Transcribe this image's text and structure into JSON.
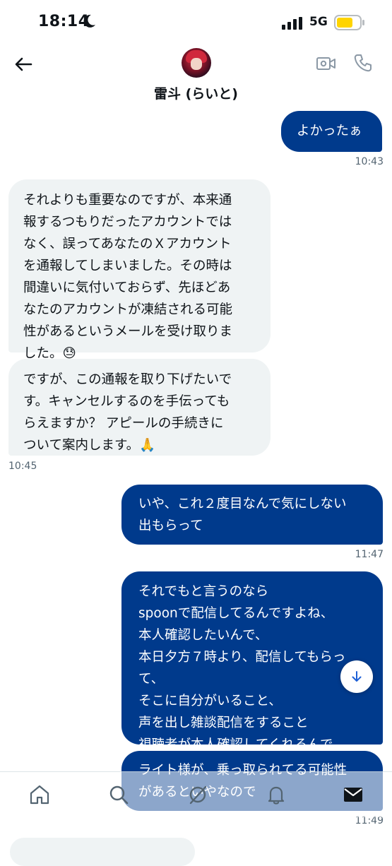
{
  "status_bar": {
    "time": "18:14",
    "network": "5G"
  },
  "header": {
    "display_name": "雷斗 (らいと)"
  },
  "messages": [
    {
      "id": "m1",
      "side": "sent",
      "text": "よかったぁ",
      "time": "10:43"
    },
    {
      "id": "m2",
      "side": "received",
      "text": "それよりも重要なのですが、本来通\n報するつもりだったアカウントでは\nなく、誤ってあなたのＸアカウント\nを通報してしまいました。その時は\n間違いに気付いておらず、先ほどあ\nなたのアカウントが凍結される可能\n性があるというメールを受け取りま\nした。😓"
    },
    {
      "id": "m3",
      "side": "received",
      "text": "ですが、この通報を取り下げたいで\nす。キャンセルするのを手伝っても\nらえますか？ アピールの手続きに\nついて案内します。🙏",
      "time": "10:45"
    },
    {
      "id": "m4",
      "side": "sent",
      "text": "いや、これ２度目なんで気にしない\n出もらって",
      "time": "11:47"
    },
    {
      "id": "m5",
      "side": "sent",
      "text": "それでもと言うのなら\nspoonで配信してるんですよね、\n本人確認したいんで、\n本日夕方７時より、配信してもらっ\nて、\nそこに自分がいること、\n声を出し雑談配信をすること\n視聴者が本人確認してくれるんで、"
    },
    {
      "id": "m6",
      "side": "sent",
      "text": "ライト様が、乗っ取られてる可能性\nがあるといやなので",
      "time": "11:49"
    }
  ],
  "icons": {
    "back": "arrow-left-icon",
    "video": "video-camera-icon",
    "call": "phone-icon",
    "scroll": "arrow-down-icon",
    "tabs": [
      "home-icon",
      "search-icon",
      "grok-icon",
      "bell-icon",
      "mail-icon"
    ]
  },
  "colors": {
    "sent_bubble": "#003a8c",
    "received_bubble": "#eff3f4",
    "battery": "#ffd400"
  }
}
